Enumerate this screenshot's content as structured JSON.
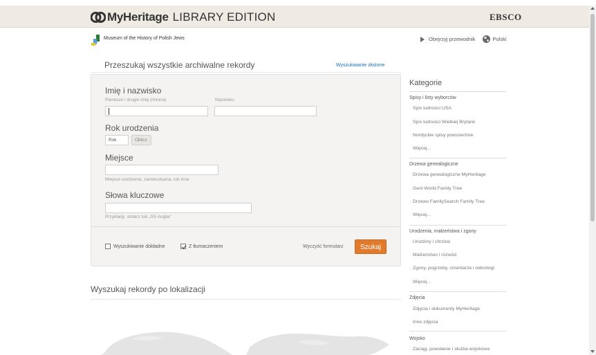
{
  "header": {
    "brand": "MyHeritage",
    "edition": "LIBRARY EDITION",
    "partner": "EBSCO"
  },
  "subbar": {
    "museum": "Museum of the History of Polish Jews",
    "guide": "Obejrzyj przewodnik",
    "language": "Polski"
  },
  "search": {
    "title": "Przeszukaj wszystkie archiwalne rekordy",
    "advanced_link": "Wyszukiwanie złożone",
    "name_label": "Imię i nazwisko",
    "first_name_hint": "Pierwsze i drugie imię (imiona)",
    "last_name_hint": "Nazwisko",
    "birth_label": "Rok urodzenia",
    "year_placeholder": "Rok",
    "calc_button": "Oblicz",
    "place_label": "Miejsce",
    "place_hint": "Miejsce urodzenia, zamieszkania, lub inne",
    "keywords_label": "Słowa kluczowe",
    "keywords_hint": "Przykłady: stolarz lub „SS Anglia”",
    "exact_label": "Wyszukiwanie dokładne",
    "exact_checked": false,
    "translate_label": "Z tłumaczeniem",
    "translate_checked": true,
    "clear_link": "Wyczyść formularz",
    "submit": "Szukaj"
  },
  "location": {
    "title": "Wyszukaj rekordy po lokalizacji"
  },
  "sidebar": {
    "title": "Kategorie",
    "groups": [
      {
        "heading": "Spisy i listy wyborców",
        "items": [
          "Spis ludności USA",
          "Spis ludności Wielkiej Brytanii",
          "Nordyckie spisy powszechne",
          "Więcej..."
        ]
      },
      {
        "heading": "Drzewa genealogiczne",
        "items": [
          "Drzewa genealogiczne MyHeritage",
          "Geni World Family Tree",
          "Drzewo FamilySearch Family Tree",
          "Więcej..."
        ]
      },
      {
        "heading": "Urodzenia, małżeństwa i zgony",
        "items": [
          "Urodziny i chrzest",
          "Małżeństwo i rozwód",
          "Zgony, pogrzeby, cmentarze i nekrologi",
          "Więcej..."
        ]
      },
      {
        "heading": "Zdjęcia",
        "items": [
          "Zdjęcia i dokumenty MyHeritage",
          "Inne zdjęcia"
        ]
      },
      {
        "heading": "Wojsko",
        "items": [
          "Zaciąg, powołanie i służba wojskowa"
        ]
      }
    ]
  },
  "colors": {
    "header_bg": "#efebe3",
    "accent_button": "#e07b2d",
    "link": "#1a6fb8"
  }
}
